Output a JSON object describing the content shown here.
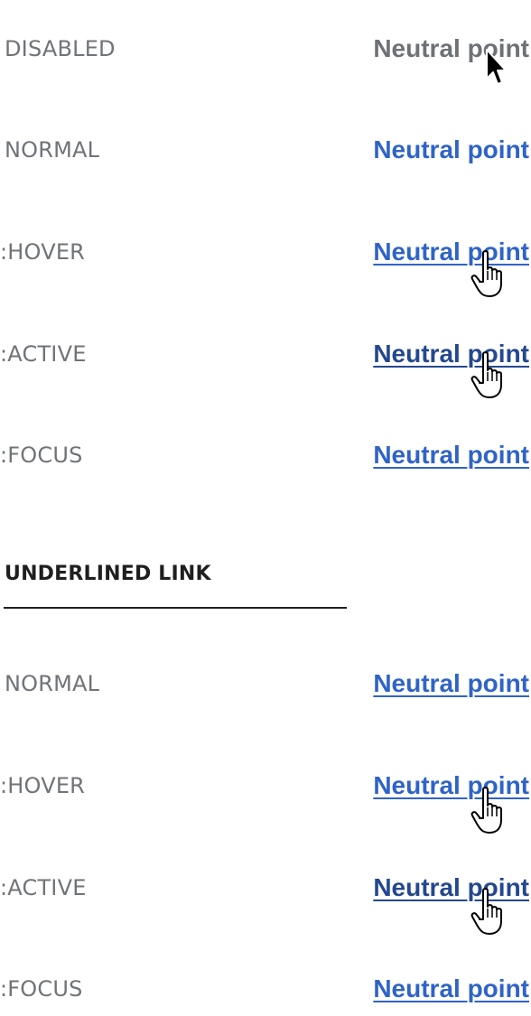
{
  "rows": [
    {
      "state": "DISABLED",
      "link": "Neutral point"
    },
    {
      "state": "NORMAL",
      "link": "Neutral point"
    },
    {
      "state": ":HOVER",
      "link": "Neutral point"
    },
    {
      "state": ":ACTIVE",
      "link": "Neutral point"
    },
    {
      "state": ":FOCUS",
      "link": "Neutral point"
    }
  ],
  "underlined_section": {
    "heading": "UNDERLINED LINK",
    "rows": [
      {
        "state": "NORMAL",
        "link": "Neutral point"
      },
      {
        "state": ":HOVER",
        "link": "Neutral point"
      },
      {
        "state": ":ACTIVE",
        "link": "Neutral point"
      },
      {
        "state": ":FOCUS",
        "link": "Neutral point"
      }
    ]
  },
  "icons": {
    "arrow_cursor": "arrow-cursor-icon",
    "hand_cursor": "hand-pointer-icon"
  },
  "colors": {
    "link": "#2f63c8",
    "link_active": "#24488f",
    "disabled": "#6e7176",
    "label": "#707378",
    "heading": "#1f1f1f"
  }
}
